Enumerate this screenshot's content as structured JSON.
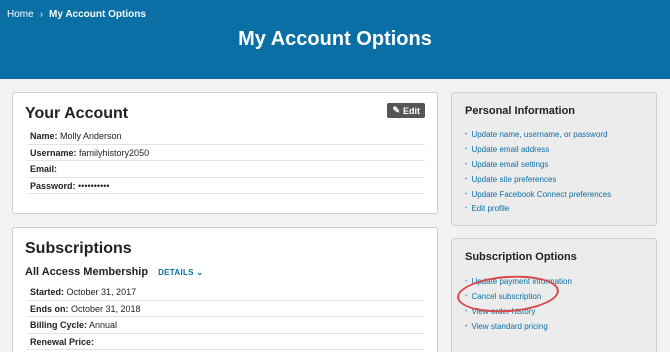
{
  "breadcrumb": {
    "home": "Home",
    "current": "My Account Options"
  },
  "page_title": "My Account Options",
  "account": {
    "title": "Your Account",
    "edit_label": "Edit",
    "fields": [
      {
        "label": "Name:",
        "value": "Molly Anderson"
      },
      {
        "label": "Username:",
        "value": "familyhistory2050"
      },
      {
        "label": "Email:",
        "value": ""
      },
      {
        "label": "Password:",
        "value": "••••••••••"
      }
    ]
  },
  "subscriptions": {
    "title": "Subscriptions",
    "plan": "All Access Membership",
    "details_label": "DETAILS",
    "fields": [
      {
        "label": "Started:",
        "value": "October 31, 2017"
      },
      {
        "label": "Ends on:",
        "value": "October 31, 2018"
      },
      {
        "label": "Billing Cycle:",
        "value": "Annual"
      },
      {
        "label": "Renewal Price:",
        "value": ""
      }
    ]
  },
  "personal_info": {
    "title": "Personal Information",
    "links": [
      "Update name, username, or password",
      "Update email address",
      "Update email settings",
      "Update site preferences",
      "Update Facebook Connect preferences",
      "Edit profile"
    ]
  },
  "subscription_options": {
    "title": "Subscription Options",
    "links": [
      "Update payment information",
      "Cancel subscription",
      "View order history",
      "View standard pricing"
    ]
  },
  "colors": {
    "brand": "#0a6fa5",
    "highlight": "#d94848"
  }
}
